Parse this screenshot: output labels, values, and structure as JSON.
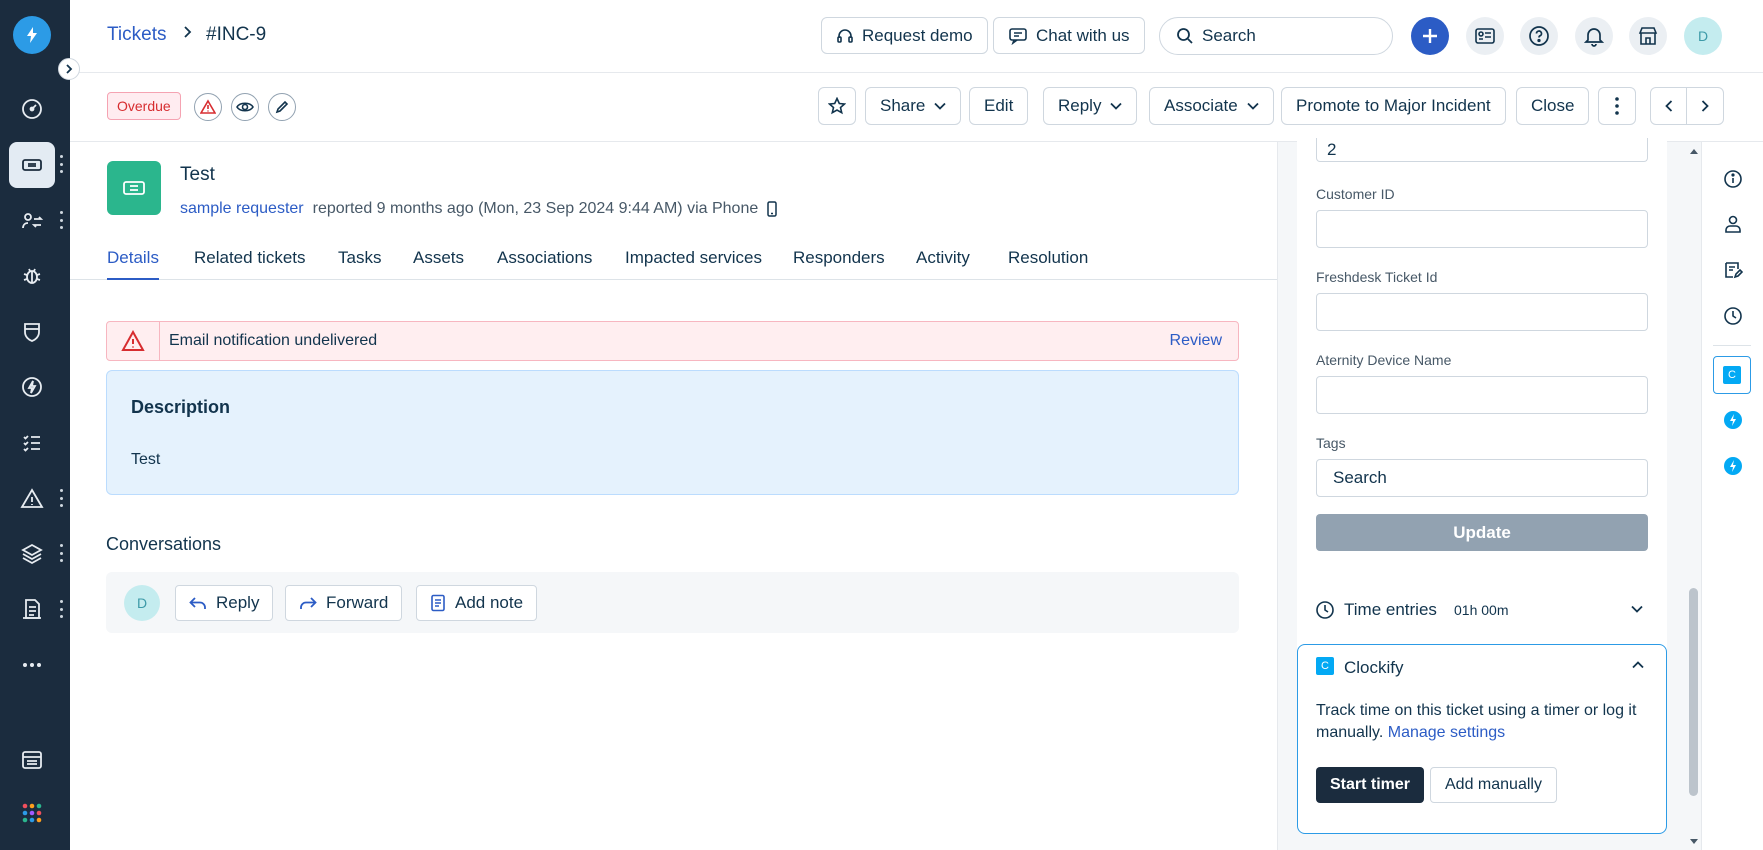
{
  "header": {
    "breadcrumb_root": "Tickets",
    "ticket_id": "#INC-9",
    "request_demo": "Request demo",
    "chat_with_us": "Chat with us",
    "search_placeholder": "Search",
    "avatar_initial": "D"
  },
  "actions": {
    "overdue": "Overdue",
    "share": "Share",
    "edit": "Edit",
    "reply": "Reply",
    "associate": "Associate",
    "promote": "Promote to Major Incident",
    "close": "Close"
  },
  "ticket": {
    "title": "Test",
    "requester": "sample requester",
    "reported": "reported 9 months ago (Mon, 23 Sep 2024 9:44 AM) via Phone"
  },
  "tabs": [
    "Details",
    "Related tickets",
    "Tasks",
    "Assets",
    "Associations",
    "Impacted services",
    "Responders",
    "Activity",
    "Resolution"
  ],
  "alert": {
    "text": "Email notification undelivered",
    "link": "Review"
  },
  "description": {
    "heading": "Description",
    "body": "Test"
  },
  "conversations": {
    "title": "Conversations",
    "avatar_initial": "D",
    "reply": "Reply",
    "forward": "Forward",
    "add_note": "Add note"
  },
  "properties": {
    "top_value": "2",
    "customer_id_label": "Customer ID",
    "customer_id_value": "",
    "freshdesk_label": "Freshdesk Ticket Id",
    "freshdesk_value": "",
    "aternity_label": "Aternity Device Name",
    "aternity_value": "",
    "tags_label": "Tags",
    "tags_placeholder": "Search",
    "update": "Update"
  },
  "time_entries": {
    "label": "Time entries",
    "value": "01h 00m"
  },
  "clockify": {
    "icon_letter": "C",
    "title": "Clockify",
    "text": "Track time on this ticket using a timer or log it manually.",
    "link": "Manage settings",
    "start": "Start timer",
    "add": "Add manually"
  },
  "colors": {
    "rail": "#1b2c3e",
    "link": "#2c5cc5",
    "ticket_icon": "#2bb68d",
    "clockify": "#03a9f4"
  }
}
